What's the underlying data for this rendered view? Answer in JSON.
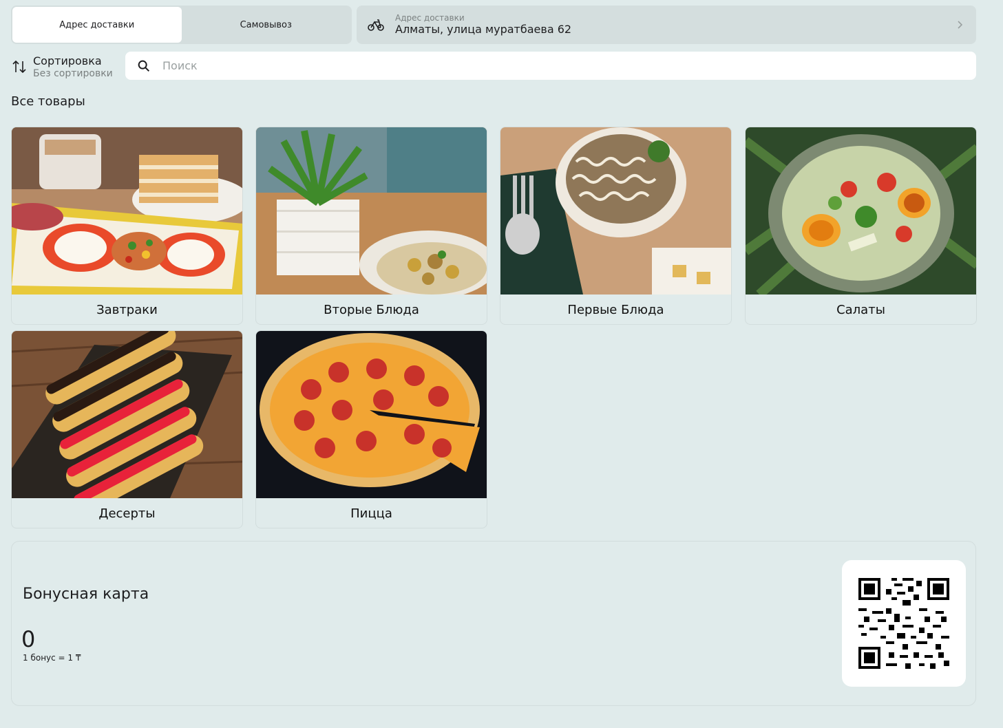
{
  "delivery_modes": {
    "delivery_label": "Адрес доставки",
    "pickup_label": "Самовывоз",
    "active": "delivery"
  },
  "address": {
    "label": "Адрес доставки",
    "value": "Алматы, улица муратбаева 62"
  },
  "sort": {
    "title": "Сортировка",
    "current": "Без сортировки"
  },
  "search": {
    "placeholder": "Поиск"
  },
  "catalog": {
    "title": "Все товары",
    "categories": [
      {
        "label": "Завтраки"
      },
      {
        "label": "Вторые Блюда"
      },
      {
        "label": "Первые Блюда"
      },
      {
        "label": "Салаты"
      },
      {
        "label": "Десерты"
      },
      {
        "label": "Пицца"
      }
    ]
  },
  "bonus_card": {
    "title": "Бонусная карта",
    "balance": "0",
    "rate": "1 бонус = 1 ₸"
  },
  "colors": {
    "background": "#e0ebeb",
    "panel": "#d4dede",
    "accent_text": "#1d1d1f"
  }
}
